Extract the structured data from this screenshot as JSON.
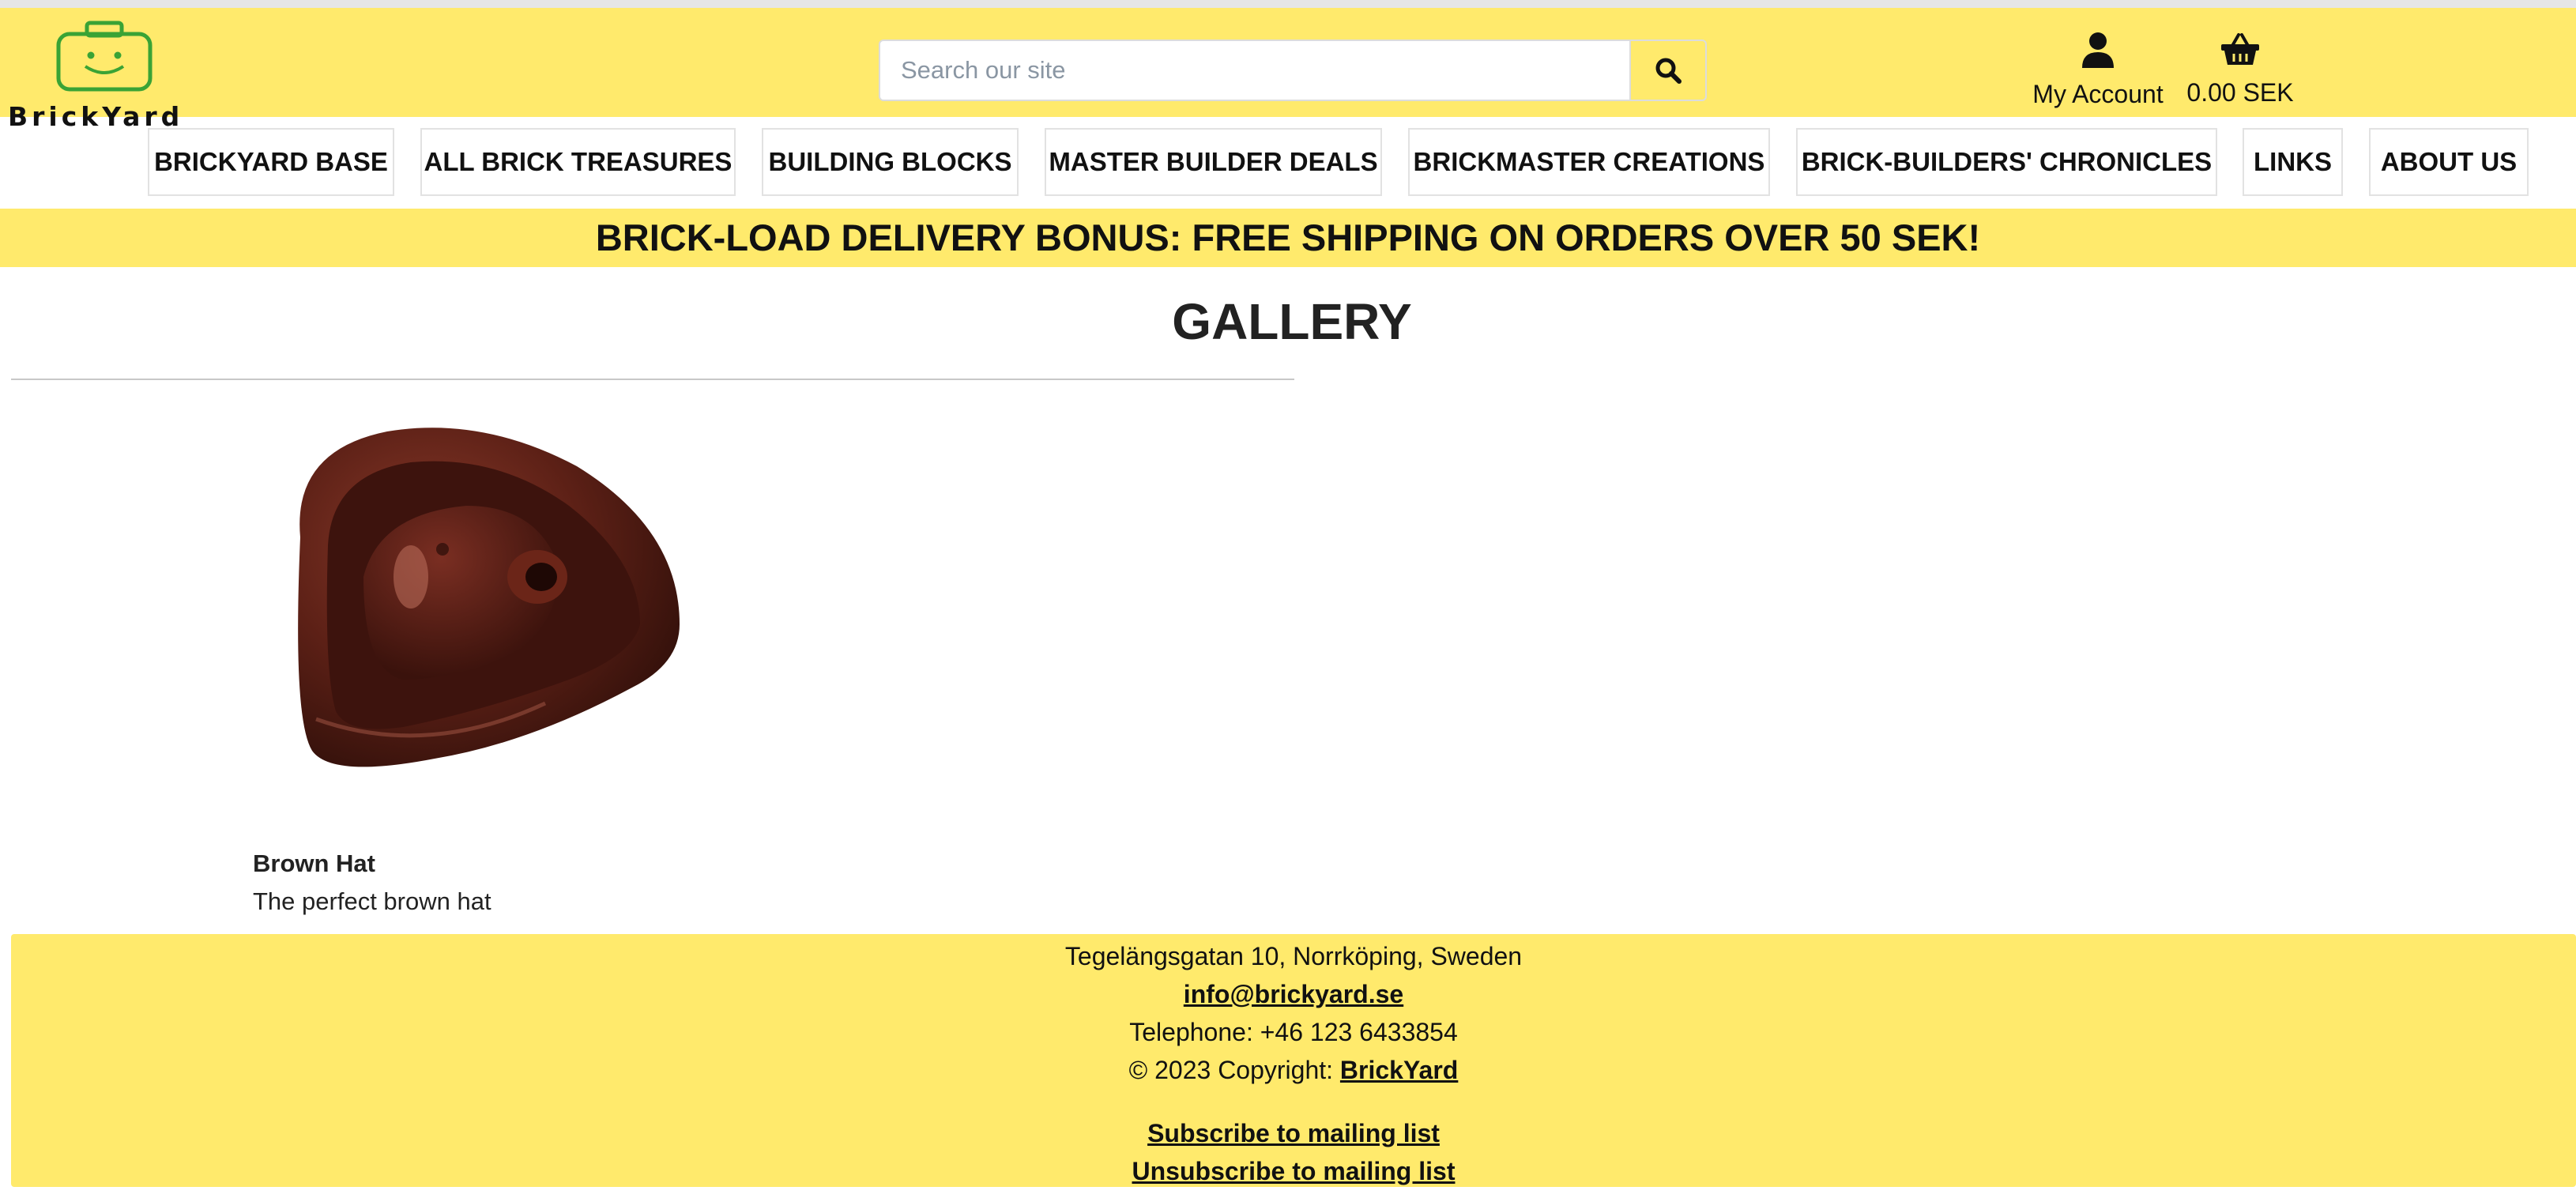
{
  "header": {
    "logo_text": "BrickYard",
    "search_placeholder": "Search our site",
    "account_label": "My Account",
    "cart_total": "0.00 SEK"
  },
  "nav": {
    "items": [
      {
        "label": "BRICKYARD BASE"
      },
      {
        "label": "ALL BRICK TREASURES"
      },
      {
        "label": "BUILDING BLOCKS"
      },
      {
        "label": "MASTER BUILDER DEALS"
      },
      {
        "label": "BRICKMASTER CREATIONS"
      },
      {
        "label": "BRICK-BUILDERS' CHRONICLES"
      },
      {
        "label": "LINKS"
      },
      {
        "label": "ABOUT US"
      }
    ]
  },
  "banner": {
    "text": "BRICK-LOAD DELIVERY BONUS: FREE SHIPPING ON ORDERS OVER 50 SEK!"
  },
  "gallery": {
    "title": "GALLERY",
    "items": [
      {
        "name": "Brown Hat",
        "description": "The perfect brown hat"
      }
    ]
  },
  "footer": {
    "address": "Tegelängsgatan 10, Norrköping, Sweden",
    "email": "info@brickyard.se",
    "telephone": "Telephone: +46 123 6433854",
    "copyright_prefix": "© 2023 Copyright:",
    "copyright_link": "BrickYard",
    "subscribe": "Subscribe to mailing list",
    "unsubscribe": "Unsubscribe to mailing list"
  },
  "colors": {
    "brand_yellow": "#ffea6c",
    "logo_green": "#3aa335"
  },
  "icons": {
    "search": "search-icon",
    "account": "user-icon",
    "cart": "basket-icon"
  }
}
